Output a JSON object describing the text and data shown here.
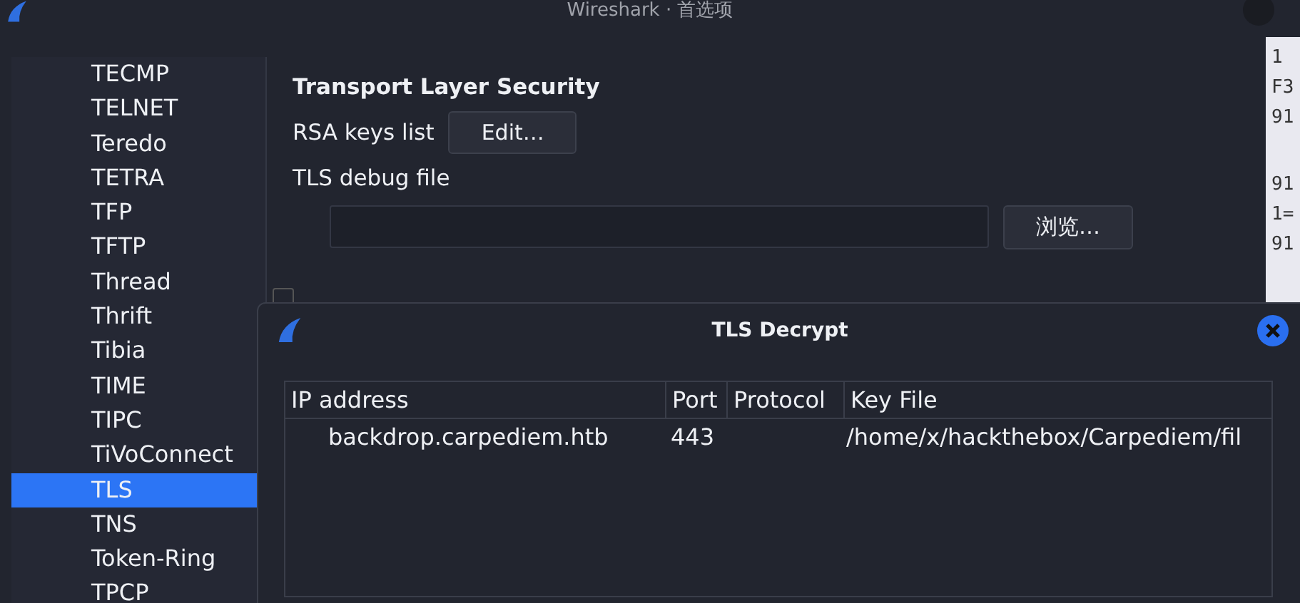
{
  "window": {
    "title": "Wireshark · 首选项"
  },
  "protocols": [
    {
      "label": "TECMP",
      "selected": false
    },
    {
      "label": "TELNET",
      "selected": false
    },
    {
      "label": "Teredo",
      "selected": false
    },
    {
      "label": "TETRA",
      "selected": false
    },
    {
      "label": "TFP",
      "selected": false
    },
    {
      "label": "TFTP",
      "selected": false
    },
    {
      "label": "Thread",
      "selected": false
    },
    {
      "label": "Thrift",
      "selected": false
    },
    {
      "label": "Tibia",
      "selected": false
    },
    {
      "label": "TIME",
      "selected": false
    },
    {
      "label": "TIPC",
      "selected": false
    },
    {
      "label": "TiVoConnect",
      "selected": false
    },
    {
      "label": "TLS",
      "selected": true
    },
    {
      "label": "TNS",
      "selected": false
    },
    {
      "label": "Token-Ring",
      "selected": false
    },
    {
      "label": "TPCP",
      "selected": false
    }
  ],
  "settings": {
    "heading": "Transport Layer Security",
    "rsa_label": "RSA keys list",
    "rsa_button": "Edit…",
    "debug_label": "TLS debug file",
    "browse_button": "浏览…",
    "reassemble_checked": false
  },
  "background_lines": [
    [
      "1",
      "F3",
      "91"
    ],
    [
      "91",
      "1=",
      "91"
    ]
  ],
  "dialog": {
    "title": "TLS Decrypt",
    "columns": [
      "IP address",
      "Port",
      "Protocol",
      "Key File"
    ],
    "rows": [
      [
        "backdrop.carpediem.htb",
        "443",
        "",
        "/home/x/hackthebox/Carpediem/fil"
      ]
    ]
  }
}
